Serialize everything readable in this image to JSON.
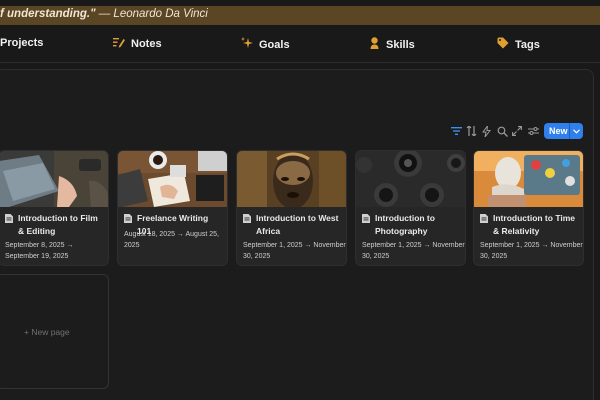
{
  "quote": {
    "text": "f understanding.\"",
    "author": " — Leonardo Da Vinci"
  },
  "nav": {
    "items": [
      {
        "label": "Projects",
        "icon": "projects-icon"
      },
      {
        "label": "Notes",
        "icon": "notes-pen-icon"
      },
      {
        "label": "Goals",
        "icon": "sparkles-icon"
      },
      {
        "label": "Skills",
        "icon": "person-icon"
      },
      {
        "label": "Tags",
        "icon": "tag-icon"
      }
    ]
  },
  "toolbar": {
    "icons": [
      "filter-icon",
      "sort-icon",
      "automation-bolt-icon",
      "search-icon",
      "expand-icon",
      "settings-sliders-icon"
    ],
    "new_label": "New"
  },
  "colors": {
    "accent": "#2f80ed",
    "quote_bar": "#5a4524",
    "nav_icon_gold": "#e0a030"
  },
  "cards": [
    {
      "title": "Introduction to Film & Editing",
      "date": "September 8, 2025 → September 19, 2025",
      "image": "laptop-desk-photo"
    },
    {
      "title": "Freelance Writing 101",
      "date": "August 18, 2025 → August 25, 2025",
      "image": "writing-desk-photo"
    },
    {
      "title": "Introduction to West Africa",
      "date": "September 1, 2025 → November 30, 2025",
      "image": "african-mask-photo"
    },
    {
      "title": "Introduction to Photography",
      "date": "September 1, 2025 → November 30, 2025",
      "image": "camera-lens-photo"
    },
    {
      "title": "Introduction to Time & Relativity",
      "date": "September 1, 2025 → November 30, 2025",
      "image": "statue-stickers-photo"
    }
  ],
  "new_page": {
    "label": "+ New page"
  }
}
